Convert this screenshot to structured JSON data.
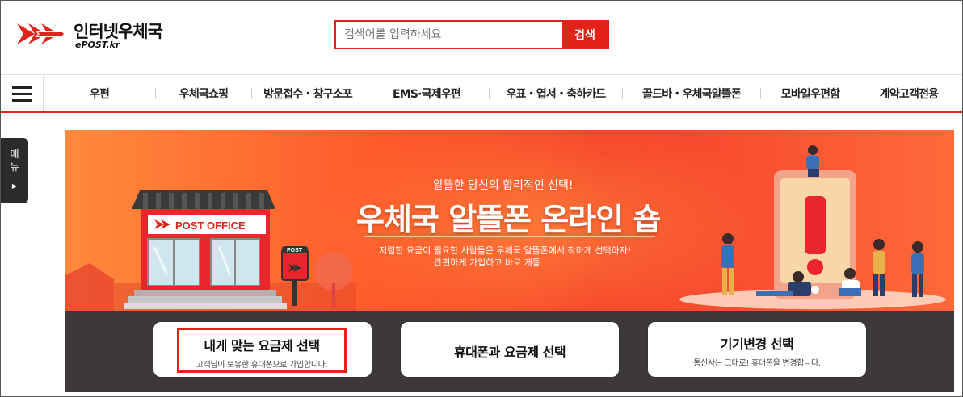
{
  "header": {
    "logo_title": "인터넷우체국",
    "logo_sub": "ePOST.kr",
    "search_placeholder": "검색어를 입력하세요",
    "search_button": "검색"
  },
  "nav": {
    "items": [
      "우편",
      "우체국쇼핑",
      "방문접수・창구소포",
      "EMS·국제우편",
      "우표・엽서・축하카드",
      "골드바・우체국알뜰폰",
      "모바일우편함",
      "계약고객전용"
    ]
  },
  "side_tab": {
    "line1": "메",
    "line2": "뉴"
  },
  "banner": {
    "eyebrow": "알뜰한 당신의 합리적인 선택!",
    "title": "우체국 알뜰폰 온라인 숍",
    "desc1": "저렴한 요금이 필요한 사람들은 우체국 알뜰폰에서 착하게 선택하자!",
    "desc2": "간편하게 가입하고 바로 개통",
    "post_office_sign": "POST OFFICE",
    "mailbox_label": "POST"
  },
  "cards": [
    {
      "title": "내게 맞는 요금제 선택",
      "sub": "고객님이 보유한 휴대폰으로 가입합니다."
    },
    {
      "title": "휴대폰과 요금제 선택",
      "sub": ""
    },
    {
      "title": "기기변경 선택",
      "sub": "통신사는 그대로! 휴대폰을 변경합니다."
    }
  ],
  "colors": {
    "brand_red": "#e2231a",
    "dark_panel": "#3d3938"
  }
}
